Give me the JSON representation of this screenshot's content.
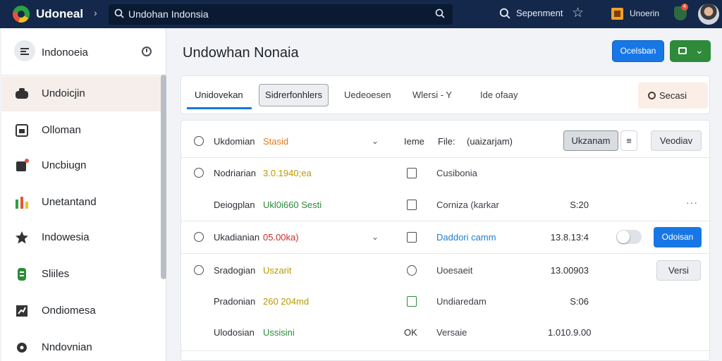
{
  "header": {
    "app_title": "Udoneal",
    "search_text": "Undohan Indonsia",
    "search_label": "Sepenment",
    "user_label": "Unoerin",
    "notification_count": "4"
  },
  "sidebar": {
    "title": "Indonoeia",
    "items": [
      {
        "label": "Undoicjin",
        "icon": "chat-bubble-icon",
        "active": true
      },
      {
        "label": "Olloman",
        "icon": "calendar-icon",
        "active": false
      },
      {
        "label": "Uncbiugn",
        "icon": "edit-icon",
        "active": false
      },
      {
        "label": "Unetantand",
        "icon": "bar-chart-icon",
        "active": false
      },
      {
        "label": "Indowesia",
        "icon": "settings-star-icon",
        "active": false
      },
      {
        "label": "Sliiles",
        "icon": "database-icon",
        "active": false
      },
      {
        "label": "Ondiomesa",
        "icon": "trend-icon",
        "active": false
      },
      {
        "label": "Nndovnian",
        "icon": "gear-icon",
        "active": false
      }
    ]
  },
  "main": {
    "title": "Undowhan Nonaia",
    "primary_button": "Ocelsban"
  },
  "tabs": {
    "active": "Unidovekan",
    "boxed": "Sidrerfonhlers",
    "tab3": "Uedeoesen",
    "tab4": "Wlersi - Y",
    "tab5": "Ide ofaay",
    "right_button": "Secasi"
  },
  "table": {
    "header": {
      "label": "Ukdomian",
      "value": "Stasid",
      "col3a": "Ieme",
      "col3b": "File:",
      "col3c": "(uaizarjam)",
      "btn1": "Ukzanam",
      "btn2": "≡",
      "btn3": "Veodiav"
    },
    "rows": [
      {
        "label": "Nodriarian",
        "value": "3.0.1940;ea",
        "color": "#b89a00",
        "col3": "Cusibonia",
        "col4": ""
      },
      {
        "label": "Deiogplan",
        "value": "Ukl0i660 Sesti",
        "color": "#2e8b3a",
        "col3": "Corniza (karkar",
        "col4": "S:20"
      },
      {
        "label": "Ukadianian",
        "value": "05.00ka)",
        "color": "#c43030",
        "col3": "Daddori camm",
        "col4": "13.8.13:4",
        "button": "Odoisan"
      },
      {
        "label": "Sradogian",
        "value": "Uszarit",
        "color": "#b89a00",
        "col3": "Uoesaeit",
        "col4": "13.00903",
        "button": "Versi"
      },
      {
        "label": "Pradonian",
        "value": "260 204md",
        "color": "#b89a00",
        "col3": "Undiaredam",
        "col4": "S:06"
      },
      {
        "label": "Ulodosian",
        "value": "Ussisini",
        "color": "#2e8b3a",
        "col3": "Versaie",
        "col3_prefix": "OK",
        "col4": "1.010.9.00"
      }
    ]
  },
  "colors": {
    "topbar": "#13284a",
    "accent_blue": "#1877e6",
    "green": "#2f8a3a"
  }
}
